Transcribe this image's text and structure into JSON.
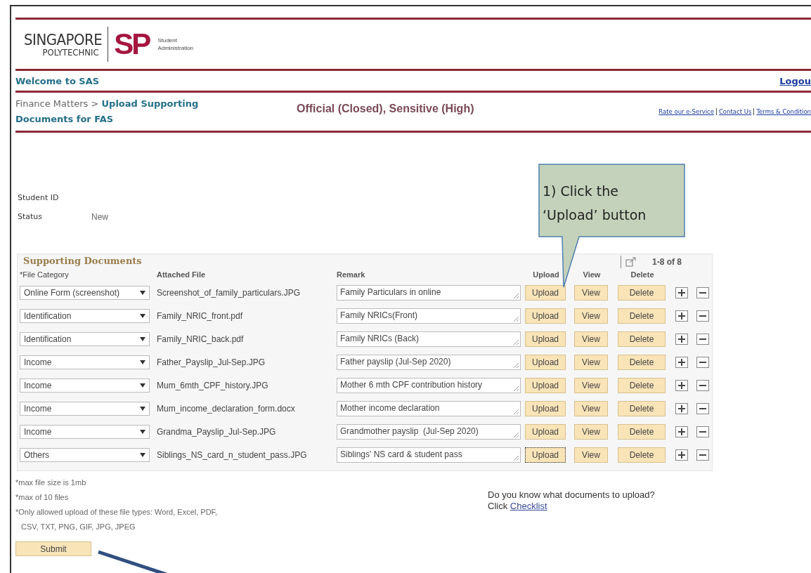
{
  "logo": {
    "line1": "SINGAPORE",
    "line2": "POLYTECHNIC",
    "mark": "SP",
    "sub1": "Student",
    "sub2": "Administration"
  },
  "welcome": "Welcome to SAS",
  "logout": "Logou",
  "breadcrumb": {
    "parent": "Finance Matters >",
    "current": "Upload Supporting Documents for FAS"
  },
  "classification": "Official (Closed), Sensitive (High)",
  "links": [
    "Rate our e-Service",
    "Contact Us",
    "Terms & Condition"
  ],
  "fields": [
    {
      "label": "Student ID"
    },
    {
      "label": "Status",
      "value": "New"
    }
  ],
  "callout": {
    "line1": "1) Click the",
    "line2": "‘Upload’ button"
  },
  "grid": {
    "title": "Supporting Documents",
    "range": "1-8 of 8",
    "columns": [
      "*File Category",
      "Attached File",
      "Remark",
      "Upload",
      "View",
      "Delete"
    ],
    "rows": [
      {
        "category": "Online Form (screenshot)",
        "file": "Screenshot_of_family_particulars.JPG",
        "remark": "Family Particulars in online",
        "upload": "Upload",
        "view": "View",
        "delete": "Delete",
        "focused": false
      },
      {
        "category": "Identification",
        "file": "Family_NRIC_front.pdf",
        "remark": "Family NRICs(Front)",
        "upload": "Upload",
        "view": "View",
        "delete": "Delete",
        "focused": false
      },
      {
        "category": "Identification",
        "file": "Family_NRIC_back.pdf",
        "remark": "Family NRICs (Back)",
        "upload": "Upload",
        "view": "View",
        "delete": "Delete",
        "focused": false
      },
      {
        "category": "Income",
        "file": "Father_Payslip_Jul-Sep.JPG",
        "remark": "Father payslip (Jul-Sep 2020)",
        "upload": "Upload",
        "view": "View",
        "delete": "Delete",
        "focused": false
      },
      {
        "category": "Income",
        "file": "Mum_6mth_CPF_history.JPG",
        "remark": "Mother 6 mth CPF contribution history",
        "upload": "Upload",
        "view": "View",
        "delete": "Delete",
        "focused": false
      },
      {
        "category": "Income",
        "file": "Mum_income_declaration_form.docx",
        "remark": "Mother income declaration",
        "upload": "Upload",
        "view": "View",
        "delete": "Delete",
        "focused": false
      },
      {
        "category": "Income",
        "file": "Grandma_Payslip_Jul-Sep.JPG",
        "remark": "Grandmother payslip  (Jul-Sep 2020)",
        "upload": "Upload",
        "view": "View",
        "delete": "Delete",
        "focused": false
      },
      {
        "category": "Others",
        "file": "Siblings_NS_card_n_student_pass.JPG",
        "remark": "Siblings' NS card & student pass",
        "upload": "Upload",
        "view": "View",
        "delete": "Delete",
        "focused": true
      }
    ]
  },
  "notes": [
    "*max file size is 1mb",
    "*max of 10 files",
    "*Only allowed upload of these file types: Word, Excel, PDF,",
    "CSV, TXT, PNG, GIF, JPG, JPEG"
  ],
  "checklist": {
    "text": "Do you know what documents to upload? Click",
    "link": "Checklist"
  },
  "submit": "Submit"
}
